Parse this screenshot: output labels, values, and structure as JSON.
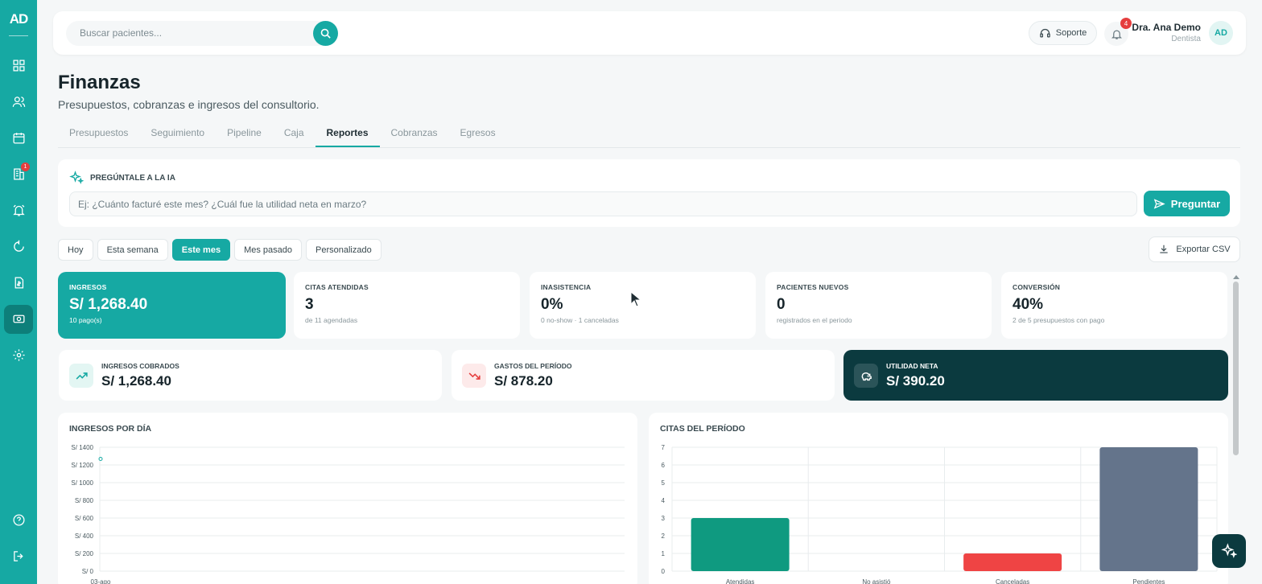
{
  "sidebar": {
    "logo": "AD",
    "nav_icons": [
      "grid-icon",
      "users-icon",
      "calendar-icon",
      "building-icon",
      "alarm-icon",
      "refresh-icon",
      "invoice-icon",
      "money-icon",
      "gear-icon"
    ],
    "building_badge": "1",
    "bottom_icons": [
      "help-icon",
      "logout-icon"
    ]
  },
  "topbar": {
    "search_placeholder": "Buscar pacientes...",
    "support_label": "Soporte",
    "notification_count": "4",
    "user_name": "Dra. Ana Demo",
    "user_role": "Dentista",
    "avatar_initials": "AD"
  },
  "page": {
    "title": "Finanzas",
    "subtitle": "Presupuestos, cobranzas e ingresos del consultorio."
  },
  "tabs": [
    {
      "label": "Presupuestos"
    },
    {
      "label": "Seguimiento"
    },
    {
      "label": "Pipeline"
    },
    {
      "label": "Caja"
    },
    {
      "label": "Reportes",
      "active": true
    },
    {
      "label": "Cobranzas"
    },
    {
      "label": "Egresos"
    }
  ],
  "ai": {
    "heading": "PREGÚNTALE A LA IA",
    "placeholder": "Ej: ¿Cuánto facturé este mes? ¿Cuál fue la utilidad neta en marzo?",
    "button_label": "Preguntar"
  },
  "filters": {
    "options": [
      "Hoy",
      "Esta semana",
      "Este mes",
      "Mes pasado",
      "Personalizado"
    ],
    "selected": "Este mes",
    "export_label": "Exportar CSV"
  },
  "stats": [
    {
      "label": "INGRESOS",
      "value": "S/ 1,268.40",
      "sub": "10 pago(s)"
    },
    {
      "label": "CITAS ATENDIDAS",
      "value": "3",
      "sub": "de 11 agendadas"
    },
    {
      "label": "INASISTENCIA",
      "value": "0%",
      "sub": "0 no-show · 1 canceladas"
    },
    {
      "label": "PACIENTES NUEVOS",
      "value": "0",
      "sub": "registrados en el periodo"
    },
    {
      "label": "CONVERSIÓN",
      "value": "40%",
      "sub": "2 de 5 presupuestos con pago"
    }
  ],
  "summary": [
    {
      "label": "INGRESOS COBRADOS",
      "value": "S/ 1,268.40"
    },
    {
      "label": "GASTOS DEL PERÍODO",
      "value": "S/ 878.20"
    },
    {
      "label": "UTILIDAD NETA",
      "value": "S/ 390.20"
    }
  ],
  "colors": {
    "primary": "#16a9a3",
    "dark": "#0b3a3f",
    "attended": "#0f9a80",
    "cancelled": "#ef4444",
    "pending": "#64748b"
  },
  "chart_data": [
    {
      "type": "line",
      "title": "INGRESOS POR DÍA",
      "x": [
        "03-ago"
      ],
      "series": [
        {
          "values": [
            1268.4
          ]
        }
      ],
      "ylim": [
        0,
        1400
      ],
      "yticks": [
        "S/ 0",
        "S/ 200",
        "S/ 400",
        "S/ 600",
        "S/ 800",
        "S/ 1000",
        "S/ 1200",
        "S/ 1400"
      ],
      "grid": true
    },
    {
      "type": "bar",
      "title": "CITAS DEL PERÍODO",
      "categories": [
        "Atendidas",
        "No asistió",
        "Canceladas",
        "Pendientes"
      ],
      "values": [
        3,
        0,
        1,
        7
      ],
      "ylim": [
        0,
        7
      ],
      "yticks": [
        "0",
        "1",
        "2",
        "3",
        "4",
        "5",
        "6",
        "7"
      ],
      "grid": true
    }
  ]
}
